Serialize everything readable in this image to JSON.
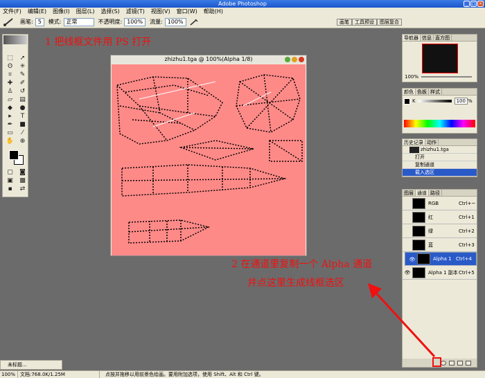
{
  "app": {
    "title": "Adobe Photoshop"
  },
  "menu": [
    "文件(F)",
    "编辑(E)",
    "图像(I)",
    "图层(L)",
    "选择(S)",
    "滤镜(T)",
    "视图(V)",
    "窗口(W)",
    "帮助(H)"
  ],
  "options": {
    "brush_label": "画笔:",
    "brush_size": "5",
    "mode_label": "模式:",
    "mode_value": "正常",
    "opacity_label": "不透明度:",
    "opacity_value": "100%",
    "flow_label": "流量:",
    "flow_value": "100%"
  },
  "palette_well_tabs": [
    "画笔",
    "工具预设",
    "图层复合"
  ],
  "annotations": {
    "step1": "1 把线框文件用 PS 打开",
    "step2_line1": "2  在通道里复制一个 Alpha 通道",
    "step2_line2": "并点这里生成线框选区"
  },
  "document": {
    "title": "zhizhu1.tga @ 100%(Alpha 1/8)"
  },
  "navigator": {
    "tabs": [
      "导航器",
      "信息",
      "直方图"
    ],
    "zoom": "100%"
  },
  "color_panel": {
    "tabs": [
      "颜色",
      "色板",
      "样式"
    ],
    "channel_label": "K",
    "value": "100",
    "unit": "%"
  },
  "history": {
    "tabs": [
      "历史记录",
      "动作"
    ],
    "snapshot": "zhizhu1.tga",
    "items": [
      "打开",
      "复制通道",
      "载入选区"
    ]
  },
  "channels": {
    "tabs": [
      "图层",
      "通道",
      "路径"
    ],
    "rows": [
      {
        "name": "RGB",
        "shortcut": "Ctrl+~"
      },
      {
        "name": "红",
        "shortcut": "Ctrl+1"
      },
      {
        "name": "绿",
        "shortcut": "Ctrl+2"
      },
      {
        "name": "蓝",
        "shortcut": "Ctrl+3"
      },
      {
        "name": "Alpha 1",
        "shortcut": "Ctrl+4"
      },
      {
        "name": "Alpha 1 副本",
        "shortcut": "Ctrl+5"
      }
    ]
  },
  "status": {
    "zoom": "100%",
    "doc": "文档:768.0K/1.25M",
    "hint": "点按并拖移以用前景色绘画。要用附加选项，使用 Shift、Alt 和 Ctrl 键。"
  },
  "minimized_doc": "未标题...",
  "colors": {
    "canvas": "#fe8a88",
    "accent_red": "#f01010",
    "selected_row": "#2a5ac8"
  }
}
